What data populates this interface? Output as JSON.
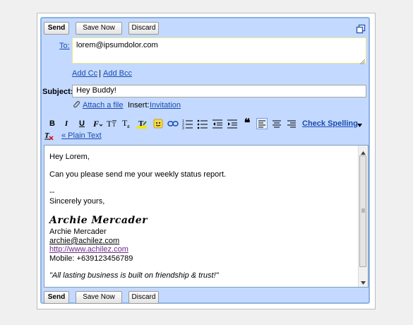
{
  "toolbar_top": {
    "send": "Send",
    "save_now": "Save Now",
    "discard": "Discard"
  },
  "toolbar_bottom": {
    "send": "Send",
    "save_now": "Save Now",
    "discard": "Discard"
  },
  "to": {
    "label": "To:",
    "value": "lorem@ipsumdolor.com"
  },
  "add_cc": "Add Cc",
  "separator": "|",
  "add_bcc": "Add Bcc",
  "subject": {
    "label": "Subject:",
    "value": "Hey Buddy!"
  },
  "attach_file": "Attach a file",
  "insert": {
    "label": "Insert:",
    "invitation": "Invitation"
  },
  "format": {
    "bold": "B",
    "italic": "I",
    "underline": "U",
    "check_spelling": "Check Spelling",
    "plain_text": "« Plain Text"
  },
  "body": {
    "greeting": "Hey Lorem,",
    "line1": "Can you please send me your weekly status report.",
    "dashes": "--",
    "closing": "Sincerely yours,",
    "signature_script": "Archie Mercader",
    "name": "Archie Mercader",
    "email": "archie@achilez.com",
    "website": "http://www.achilez.com",
    "mobile": "Mobile: +639123456789",
    "quote": "\"All lasting business is built on friendship & trust!\""
  },
  "colors": {
    "panel": "#c3d9ff",
    "link": "#1a4bb0",
    "visited": "#6f2a8b"
  }
}
